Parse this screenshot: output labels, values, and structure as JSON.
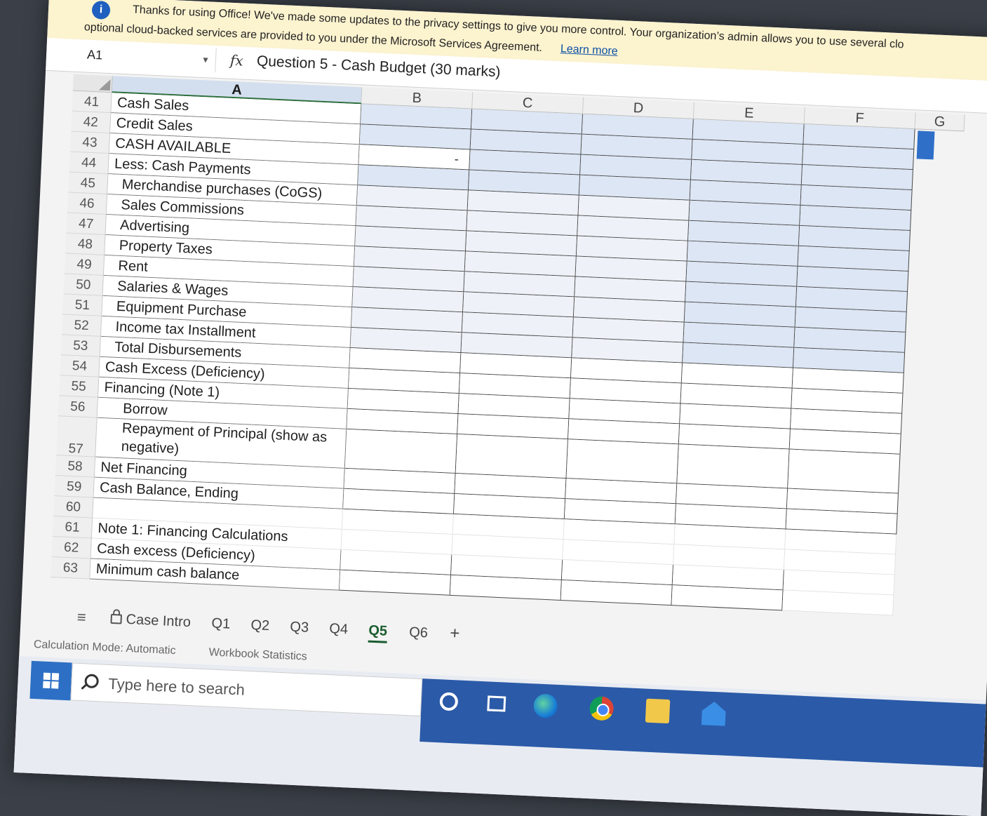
{
  "notification": {
    "line1": "Thanks for using Office! We've made some updates to the privacy settings to give you more control. Your organization’s admin allows you to use several clo",
    "line2": "optional cloud-backed services are provided to you under the Microsoft Services Agreement.",
    "learn_more": "Learn more"
  },
  "formula_bar": {
    "name_box": "A1",
    "content": "Question 5 - Cash Budget (30 marks)"
  },
  "columns": [
    "A",
    "B",
    "C",
    "D",
    "E",
    "F",
    "G"
  ],
  "rows": [
    {
      "num": "41",
      "label": "Cash Sales"
    },
    {
      "num": "42",
      "label": "Credit Sales"
    },
    {
      "num": "43",
      "label": "CASH AVAILABLE"
    },
    {
      "num": "44",
      "label": "Less: Cash Payments"
    },
    {
      "num": "45",
      "label": "Merchandise purchases (CoGS)"
    },
    {
      "num": "46",
      "label": "Sales Commissions"
    },
    {
      "num": "47",
      "label": "Advertising"
    },
    {
      "num": "48",
      "label": "Property Taxes"
    },
    {
      "num": "49",
      "label": "Rent"
    },
    {
      "num": "50",
      "label": "Salaries & Wages"
    },
    {
      "num": "51",
      "label": "Equipment Purchase"
    },
    {
      "num": "52",
      "label": "Income tax Installment"
    },
    {
      "num": "53",
      "label": "Total Disbursements"
    },
    {
      "num": "54",
      "label": "Cash Excess (Deficiency)"
    },
    {
      "num": "55",
      "label": "Financing (Note 1)"
    },
    {
      "num": "56",
      "label": "Borrow"
    },
    {
      "num": "57",
      "label": "Repayment of Principal (show as negative)"
    },
    {
      "num": "58",
      "label": "Net Financing"
    },
    {
      "num": "59",
      "label": "Cash Balance, Ending"
    },
    {
      "num": "60",
      "label": ""
    },
    {
      "num": "61",
      "label": "Note 1: Financing Calculations"
    },
    {
      "num": "62",
      "label": "Cash excess (Deficiency)"
    },
    {
      "num": "63",
      "label": "Minimum cash balance"
    }
  ],
  "cell_b43": "-",
  "sheet_tabs": {
    "case_intro": "Case Intro",
    "tabs": [
      "Q1",
      "Q2",
      "Q3",
      "Q4",
      "Q5",
      "Q6"
    ],
    "active": "Q5",
    "add": "+"
  },
  "status_bar": {
    "calc_mode": "Calculation Mode: Automatic",
    "stats": "Workbook Statistics"
  },
  "taskbar": {
    "search_placeholder": "Type here to search",
    "icons": [
      "cortana-icon",
      "task-view-icon",
      "edge-icon",
      "chrome-icon",
      "file-explorer-icon",
      "mail-icon"
    ]
  },
  "colors": {
    "notification_bg": "#fcf3cf",
    "input_cell_blue": "#dce6f4",
    "active_tab": "#1a5c2e",
    "taskbar_accent": "#2b5aa8"
  }
}
